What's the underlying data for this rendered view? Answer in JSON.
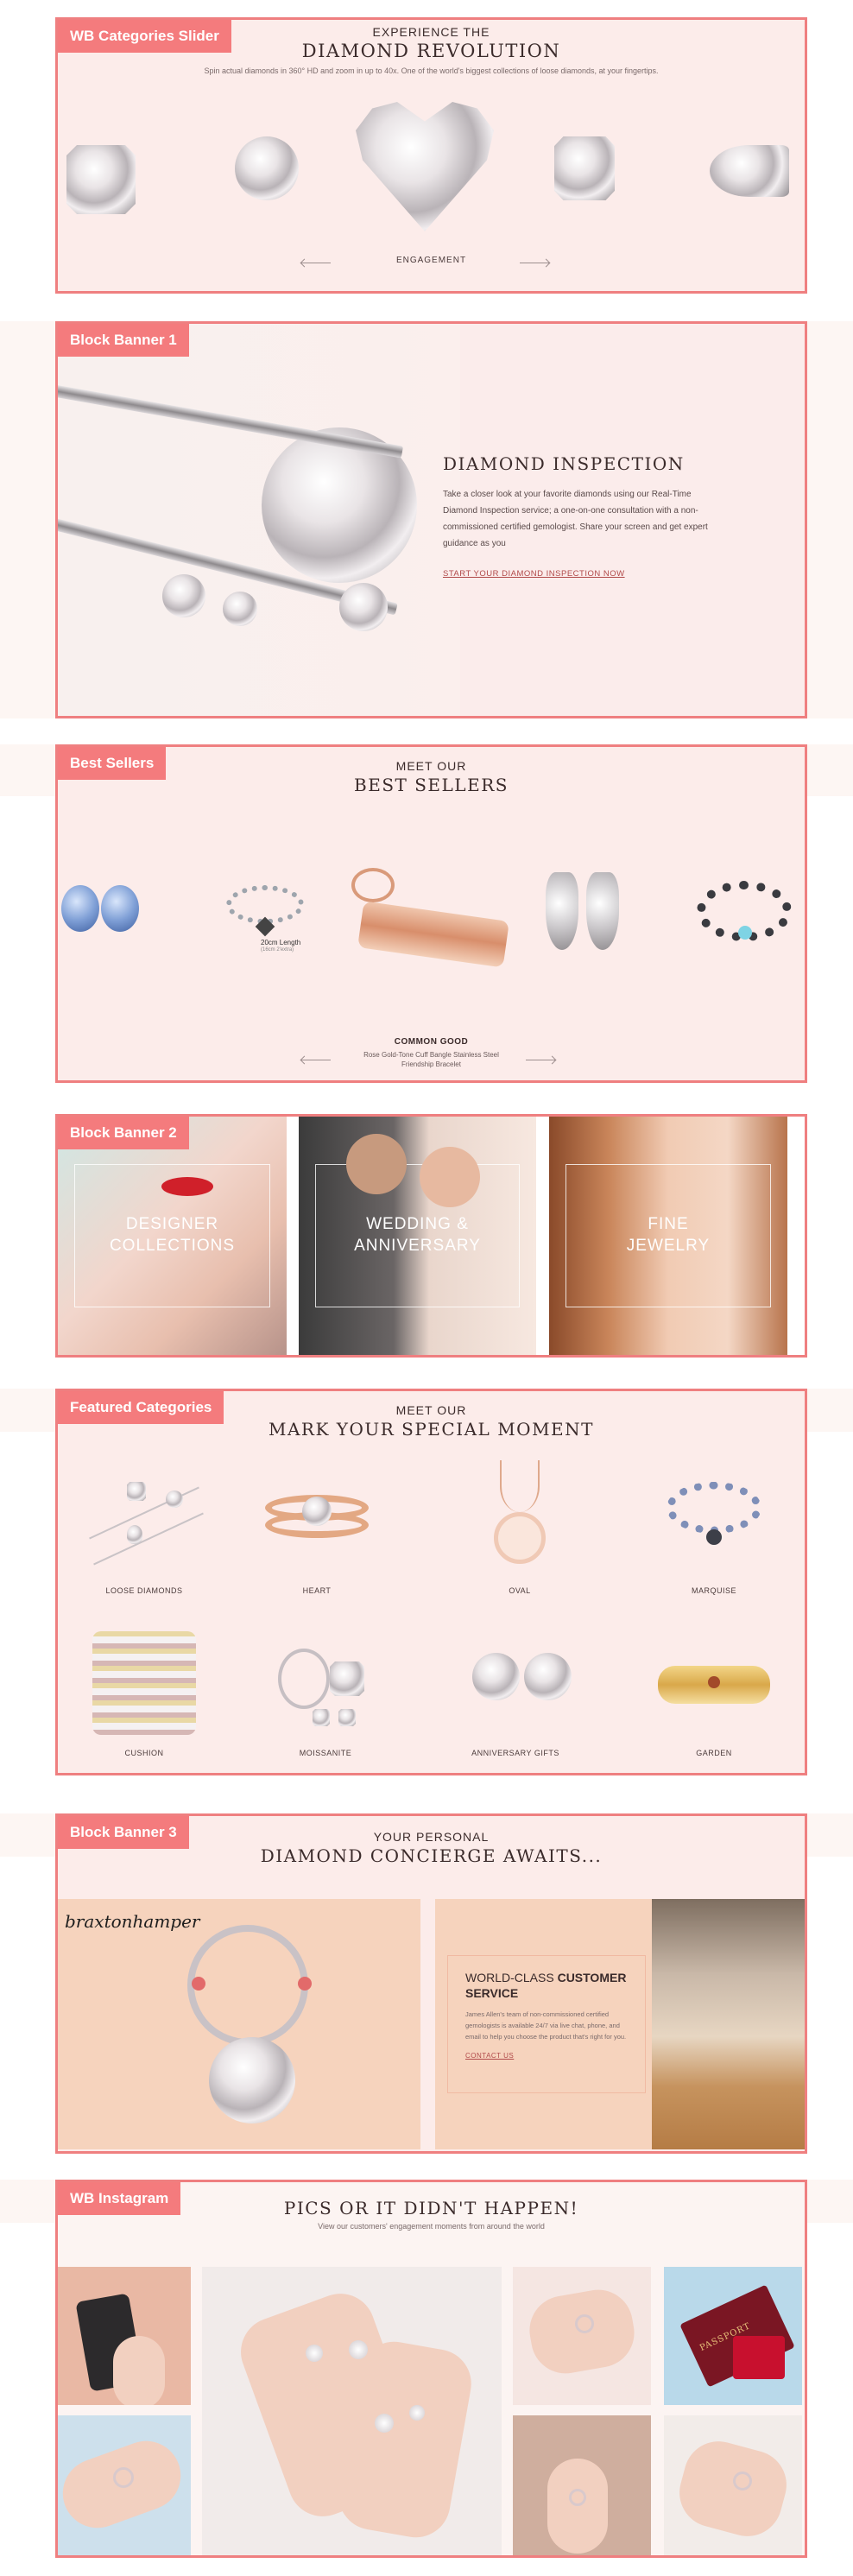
{
  "slider": {
    "tag": "WB Categories Slider",
    "kicker": "EXPERIENCE THE",
    "title": "DIAMOND REVOLUTION",
    "subtitle": "Spin actual diamonds in 360° HD and zoom in up to 40x. One of the world's biggest collections of loose diamonds, at your fingertips.",
    "active_label": "ENGAGEMENT"
  },
  "banner1": {
    "tag": "Block Banner 1",
    "title": "DIAMOND INSPECTION",
    "body": "Take a closer look at your favorite diamonds using our Real-Time Diamond Inspection service; a one-on-one consultation with a non-commissioned certified gemologist. Share your screen and get expert guidance as you",
    "cta": "START YOUR DIAMOND INSPECTION NOW"
  },
  "best": {
    "tag": "Best Sellers",
    "kicker": "MEET OUR",
    "title": "BEST SELLERS",
    "engraving": "20cm Length",
    "engraving_sub": "(16cm 2'extra)",
    "product_title": "COMMON GOOD",
    "product_sub": "Rose Gold-Tone Cuff Bangle Stainless Steel Friendship Bracelet"
  },
  "banner2": {
    "tag": "Block Banner 2",
    "tiles": [
      {
        "line1": "DESIGNER",
        "line2": "COLLECTIONS"
      },
      {
        "line1": "WEDDING &",
        "line2": "ANNIVERSARY"
      },
      {
        "line1": "FINE",
        "line2": "JEWELRY"
      }
    ]
  },
  "featured": {
    "tag": "Featured Categories",
    "kicker": "MEET OUR",
    "title": "MARK YOUR SPECIAL MOMENT",
    "items": [
      "LOOSE DIAMONDS",
      "HEART",
      "OVAL",
      "MARQUISE",
      "CUSHION",
      "MOISSANITE",
      "ANNIVERSARY GIFTS",
      "GARDEN"
    ]
  },
  "banner3": {
    "tag": "Block Banner 3",
    "kicker": "YOUR PERSONAL",
    "title": "DIAMOND CONCIERGE AWAITS...",
    "brand": "braxtonhamper",
    "card_kicker": "WORLD-CLASS",
    "card_title_a": "CUSTOMER",
    "card_title_b": "SERVICE",
    "card_body": "James Allen's team of non-commissioned certified gemologists is available 24/7 via live chat, phone, and email to help you choose the product that's right for you.",
    "card_cta": "CONTACT US"
  },
  "insta": {
    "tag": "WB Instagram",
    "title": "PICS OR IT DIDN'T HAPPEN!",
    "subtitle": "View our customers' engagement moments from around the world",
    "passport": "PASSPORT"
  },
  "colors": {
    "accent": "#f47b7d",
    "border": "#ef7f80",
    "panel": "#fcecea",
    "band": "#fdf6f3"
  }
}
